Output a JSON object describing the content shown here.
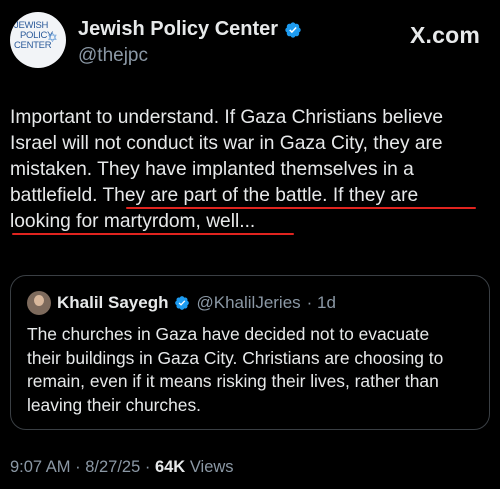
{
  "author": {
    "display_name": "Jewish Policy Center",
    "handle": "@thejpc",
    "avatar_logo_text": [
      "JEWISH",
      "POLICY",
      "CENTER"
    ]
  },
  "site_label": "X.com",
  "tweet": {
    "lines": [
      "Important to understand. If Gaza Christians believe",
      "Israel will not conduct its war in Gaza City, they are",
      "mistaken. They have implanted themselves in a",
      "battlefield. ",
      "They are part of the battle. If they are",
      "looking for martyrdom, well..."
    ]
  },
  "quote": {
    "display_name": "Khalil Sayegh",
    "handle": "@KhalilJeries",
    "time_ago": "· 1d",
    "lines": [
      "The churches in Gaza have decided not to evacuate",
      "their buildings in Gaza City. Christians are choosing to",
      "remain, even if it means risking their lives, rather than",
      "leaving their churches."
    ]
  },
  "meta": {
    "time": "9:07 AM",
    "date": "· 8/27/25 ·",
    "views_count": "64K",
    "views_label": "Views"
  },
  "colors": {
    "verified": "#1d9bf0",
    "annotation_underline": "#e0241f"
  }
}
